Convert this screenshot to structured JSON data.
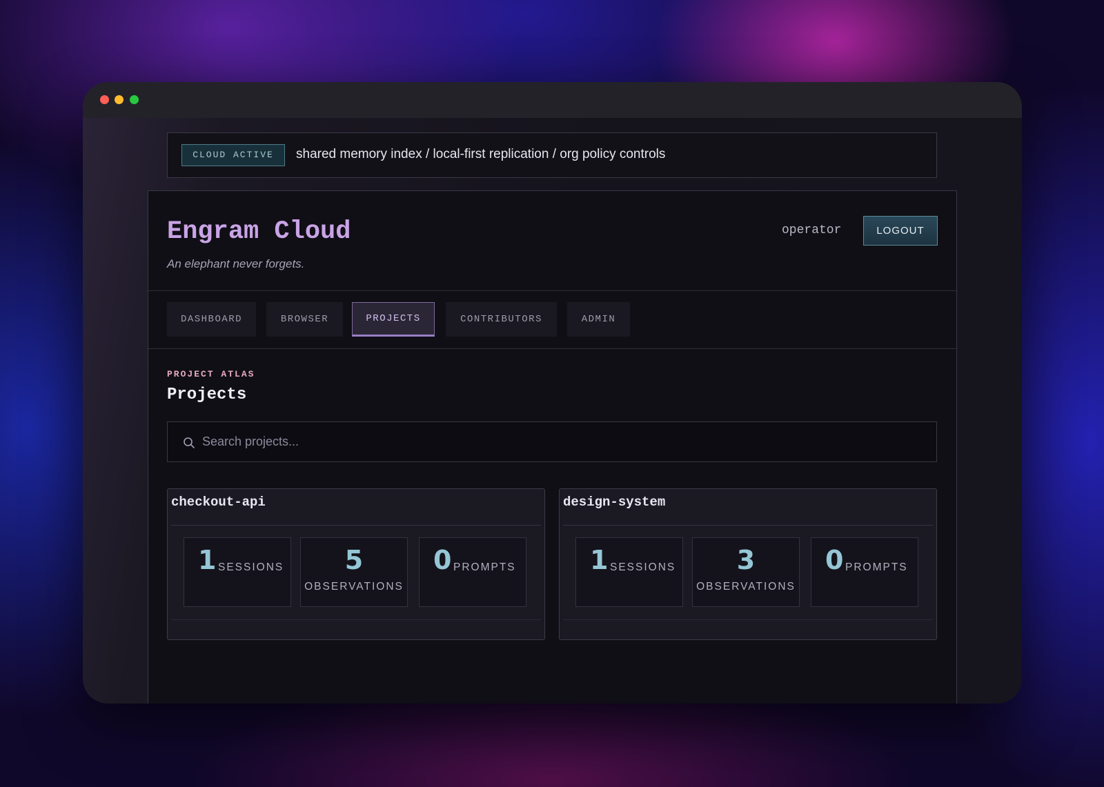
{
  "banner": {
    "badge": "CLOUD ACTIVE",
    "text": "shared memory index / local-first replication / org policy controls"
  },
  "header": {
    "title": "Engram Cloud",
    "tagline": "An elephant never forgets.",
    "user": "operator",
    "logout_label": "LOGOUT"
  },
  "nav": {
    "tabs": [
      {
        "label": "DASHBOARD",
        "active": false
      },
      {
        "label": "BROWSER",
        "active": false
      },
      {
        "label": "PROJECTS",
        "active": true
      },
      {
        "label": "CONTRIBUTORS",
        "active": false
      },
      {
        "label": "ADMIN",
        "active": false
      }
    ]
  },
  "main": {
    "eyebrow": "PROJECT ATLAS",
    "title": "Projects",
    "search": {
      "placeholder": "Search projects...",
      "value": "",
      "icon": "search-icon"
    },
    "projects": [
      {
        "name": "checkout-api",
        "stats": [
          {
            "value": "1",
            "label": "SESSIONS"
          },
          {
            "value": "5",
            "label": "OBSERVATIONS"
          },
          {
            "value": "0",
            "label": "PROMPTS"
          }
        ]
      },
      {
        "name": "design-system",
        "stats": [
          {
            "value": "1",
            "label": "SESSIONS"
          },
          {
            "value": "3",
            "label": "OBSERVATIONS"
          },
          {
            "value": "0",
            "label": "PROMPTS"
          }
        ]
      }
    ]
  },
  "colors": {
    "accent": "#c9a4e6",
    "stat_value": "#95c6d6",
    "badge_border": "#4f7c8a",
    "eyebrow": "#e6a9bf"
  }
}
